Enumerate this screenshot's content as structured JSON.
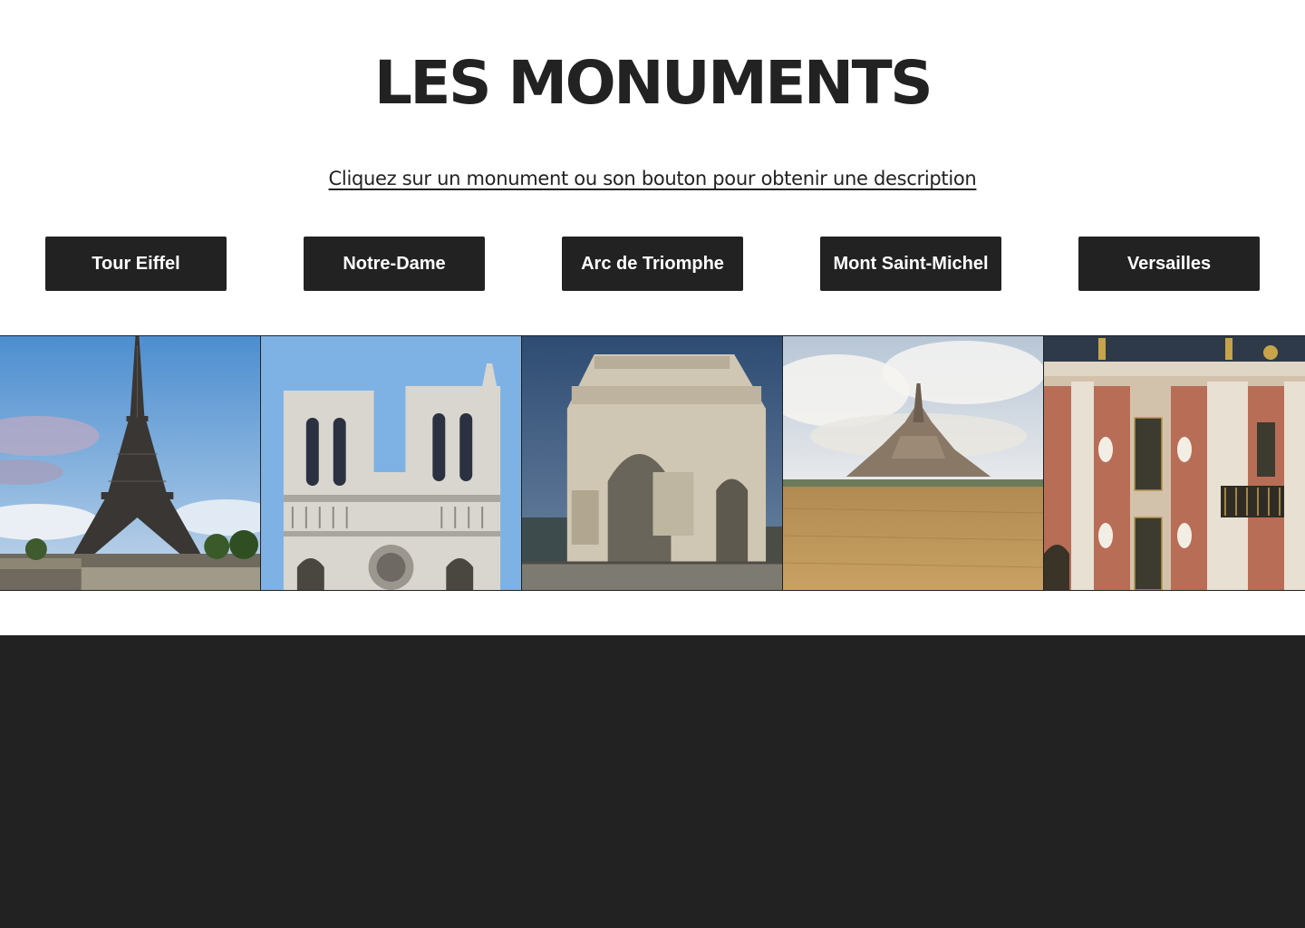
{
  "header": {
    "title": "LES MONUMENTS",
    "subtitle": "Cliquez sur un monument ou son bouton pour obtenir une description"
  },
  "buttons": [
    {
      "label": "Tour Eiffel"
    },
    {
      "label": "Notre-Dame"
    },
    {
      "label": "Arc de Triomphe"
    },
    {
      "label": "Mont Saint-Michel"
    },
    {
      "label": "Versailles"
    }
  ],
  "gallery": [
    {
      "name": "eiffel-tower-photo"
    },
    {
      "name": "notre-dame-photo"
    },
    {
      "name": "arc-de-triomphe-photo"
    },
    {
      "name": "mont-saint-michel-photo"
    },
    {
      "name": "versailles-photo"
    }
  ],
  "colors": {
    "text": "#222222",
    "button_bg": "#222222",
    "button_text": "#ffffff",
    "footer_bg": "#222222",
    "background": "#ffffff"
  }
}
